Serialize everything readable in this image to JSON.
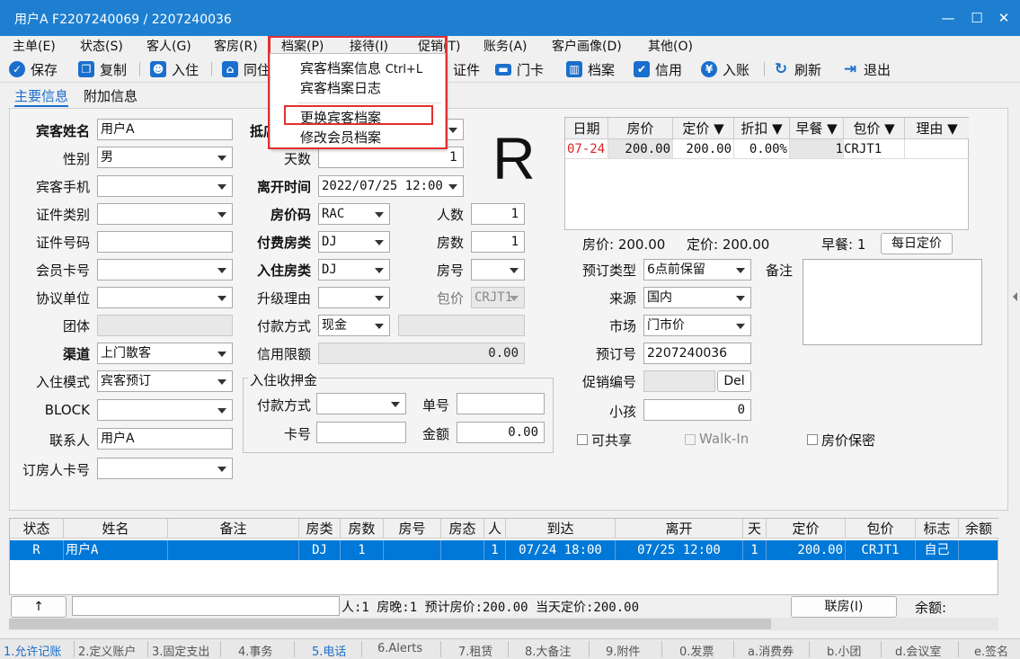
{
  "window": {
    "title": "用户A  F2207240069 / 2207240036"
  },
  "menu": [
    "主单(E)",
    "状态(S)",
    "客人(G)",
    "客房(R)",
    "档案(P)",
    "接待(I)",
    "促销(T)",
    "账务(A)",
    "客户画像(D)",
    "其他(O)"
  ],
  "toolbar": {
    "save": "保存",
    "copy": "复制",
    "checkin": "入住",
    "same": "同住",
    "cert": "证件",
    "card": "门卡",
    "profile": "档案",
    "credit": "信用",
    "post": "入账",
    "refresh": "刷新",
    "exit": "退出"
  },
  "tabs": {
    "main": "主要信息",
    "extra": "附加信息"
  },
  "dropdown": {
    "item1": "宾客档案信息",
    "item1_shortcut": "Ctrl+L",
    "item2": "宾客档案日志",
    "item3": "更换宾客档案",
    "item4": "修改会员档案"
  },
  "form": {
    "guest_name_label": "宾客姓名",
    "guest_name": "用户A",
    "gender_label": "性别",
    "gender": "男",
    "phone_label": "宾客手机",
    "phone": "",
    "idtype_label": "证件类别",
    "idtype": "",
    "idno_label": "证件号码",
    "idno": "",
    "member_label": "会员卡号",
    "member": "",
    "company_label": "协议单位",
    "company": "",
    "group_label": "团体",
    "group": "",
    "channel_label": "渠道",
    "channel": "上门散客",
    "mode_label": "入住模式",
    "mode": "宾客预订",
    "block_label": "BLOCK",
    "block": "",
    "contact_label": "联系人",
    "contact": "用户A",
    "booker_label": "订房人卡号",
    "booker": "",
    "arrive_label": "抵店",
    "arrive": "",
    "days_label": "天数",
    "days": "1",
    "depart_label": "离开时间",
    "depart": "2022/07/25 12:00",
    "ratecode_label": "房价码",
    "ratecode": "RAC",
    "paytype_label": "付费房类",
    "paytype": "DJ",
    "roomtype_label": "入住房类",
    "roomtype": "DJ",
    "upgrade_label": "升级理由",
    "upgrade": "",
    "paymethod_label": "付款方式",
    "paymethod": "现金",
    "creditlimit_label": "信用限额",
    "creditlimit": "0.00",
    "persons_label": "人数",
    "persons": "1",
    "rooms_label": "房数",
    "rooms": "1",
    "roomno_label": "房号",
    "roomno": "",
    "package_label": "包价",
    "package": "CRJT1",
    "deposit_title": "入住收押金",
    "dep_pay_label": "付款方式",
    "dep_pay": "",
    "dep_no_label": "单号",
    "dep_no": "",
    "dep_card_label": "卡号",
    "dep_card": "",
    "dep_amt_label": "金额",
    "dep_amt": "0.00",
    "booktype_label": "预订类型",
    "booktype": "6点前保留",
    "source_label": "来源",
    "source": "国内",
    "market_label": "市场",
    "market": "门市价",
    "bookno_label": "预订号",
    "bookno": "2207240036",
    "promo_label": "促销编号",
    "promo": "",
    "del_btn": "Del",
    "kids_label": "小孩",
    "kids": "0",
    "remark_label": "备注",
    "share_label": "可共享",
    "walkin_label": "Walk-In",
    "secret_label": "房价保密",
    "big_status": "R"
  },
  "rate_grid": {
    "headers": [
      "日期",
      "房价",
      "定价",
      "折扣",
      "早餐",
      "包价",
      "理由"
    ],
    "row": [
      "07-24",
      "200.00",
      "200.00",
      "0.00%",
      "1",
      "CRJT1",
      ""
    ],
    "summary_rate": "房价: 200.00",
    "summary_fixed": "定价: 200.00",
    "summary_bf": "早餐: 1",
    "daily_btn": "每日定价"
  },
  "booking_grid": {
    "headers": [
      "状态",
      "姓名",
      "备注",
      "房类",
      "房数",
      "房号",
      "房态",
      "人",
      "到达",
      "离开",
      "天",
      "定价",
      "包价",
      "标志",
      "余额"
    ],
    "row": [
      "R",
      "用户A",
      "",
      "DJ",
      "1",
      "",
      "",
      "1",
      "07/24 18:00",
      "07/25 12:00",
      "1",
      "200.00",
      "CRJT1",
      "自己",
      ""
    ]
  },
  "footer": {
    "arrow_btn": "↑",
    "info": "人:1  房晚:1  预计房价:200.00  当天定价:200.00",
    "link_btn": "联房(I)",
    "balance": "余额:"
  },
  "status_tabs": [
    "1.允许记账",
    "2.定义账户",
    "3.固定支出",
    "4.事务",
    "5.电话",
    "6.Alerts",
    "7.租赁",
    "8.大备注",
    "9.附件",
    "0.发票",
    "a.消费券",
    "b.小团",
    "d.会议室",
    "e.签名"
  ],
  "colors": {
    "titlebar": "#1e7fd0",
    "accent": "#1a6fcc",
    "highlight_box": "#e03030",
    "selected_row": "#0078d7"
  }
}
